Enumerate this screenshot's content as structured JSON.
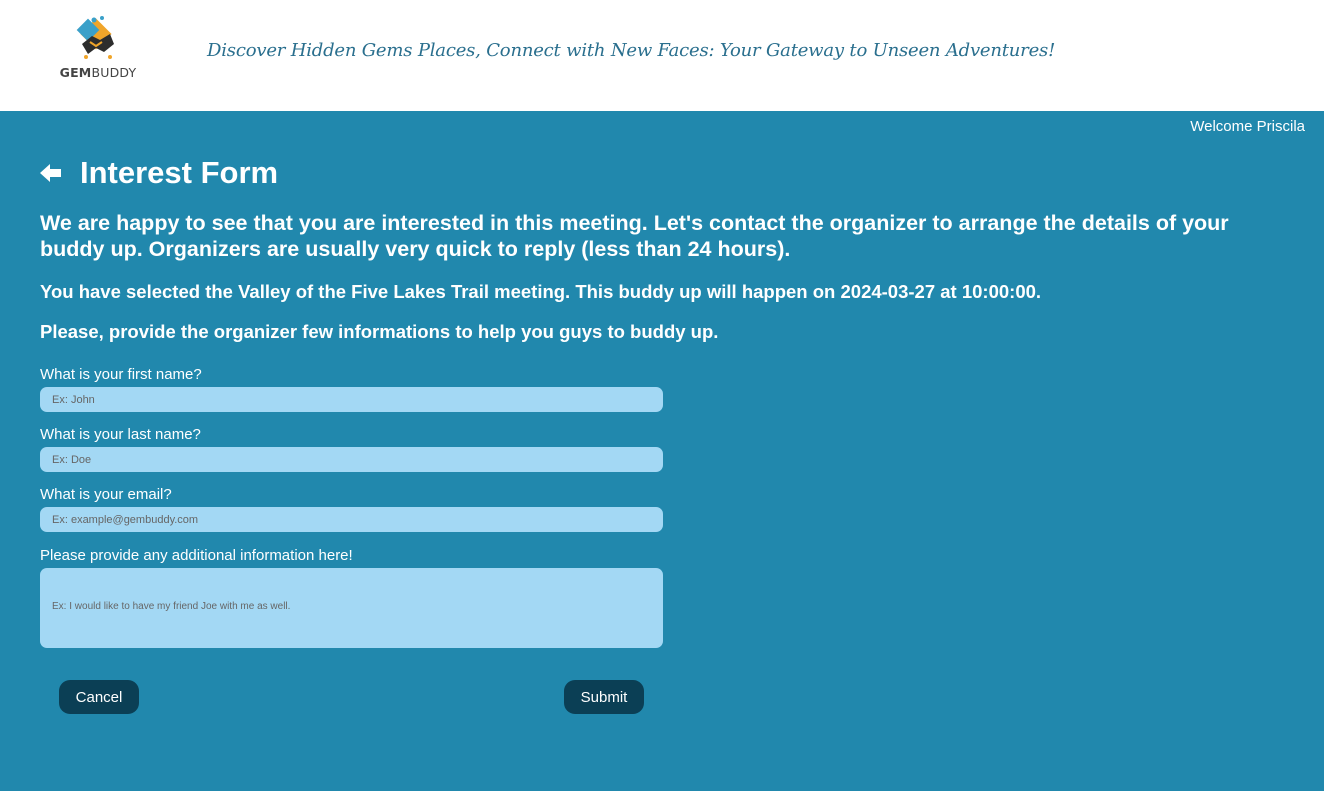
{
  "header": {
    "logo_text_bold": "GEM",
    "logo_text": "BUDDY",
    "tagline": "Discover Hidden Gems Places, Connect with New Faces: Your Gateway to Unseen Adventures!"
  },
  "user": {
    "welcome": "Welcome Priscila"
  },
  "page": {
    "title": "Interest Form",
    "intro": "We are happy to see that you are interested in this meeting. Let's contact the organizer to arrange the details of your buddy up. Organizers are usually very quick to reply (less than 24 hours).",
    "selected": "You have selected the Valley of the Five Lakes Trail meeting. This buddy up will happen on 2024-03-27 at 10:00:00.",
    "provide": "Please, provide the organizer few informations to help you guys to buddy up."
  },
  "form": {
    "first_name": {
      "label": "What is your first name?",
      "placeholder": "Ex: John",
      "value": ""
    },
    "last_name": {
      "label": "What is your last name?",
      "placeholder": "Ex: Doe",
      "value": ""
    },
    "email": {
      "label": "What is your email?",
      "placeholder": "Ex: example@gembuddy.com",
      "value": ""
    },
    "additional": {
      "label": "Please provide any additional information here!",
      "placeholder": "Ex: I would like to have my friend Joe with me as well.",
      "value": ""
    },
    "cancel_label": "Cancel",
    "submit_label": "Submit"
  },
  "colors": {
    "background": "#2188ad",
    "input_bg": "#a3d8f4",
    "button_bg": "#0b3f55",
    "tagline": "#2a6f8e"
  },
  "icons": {
    "back": "arrow-left-icon",
    "logo": "handshake-icon"
  }
}
